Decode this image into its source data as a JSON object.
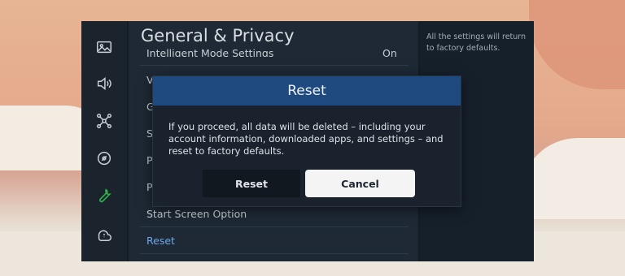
{
  "screen": {
    "title": "General & Privacy",
    "menu": [
      {
        "label": "Intelligent Mode Settings",
        "value": "On"
      },
      {
        "label": "V"
      },
      {
        "label": "G"
      },
      {
        "label": "S"
      },
      {
        "label": "P"
      },
      {
        "label": "P"
      },
      {
        "label": "Start Screen Option"
      },
      {
        "label": "Reset"
      }
    ],
    "help_text": "All the settings will return to factory defaults."
  },
  "sidebar_icons": [
    "picture-icon",
    "sound-icon",
    "connection-icon",
    "broadcast-icon",
    "wrench-icon",
    "support-icon"
  ],
  "dialog": {
    "title": "Reset",
    "message": "If you proceed, all data will be deleted – including your account information, downloaded apps, and settings – and reset to factory defaults.",
    "reset_label": "Reset",
    "cancel_label": "Cancel"
  },
  "colors": {
    "dialog_header": "#1f4a80",
    "focused_button": "#f4f4f4",
    "reset_text": "#6ea8ea"
  }
}
